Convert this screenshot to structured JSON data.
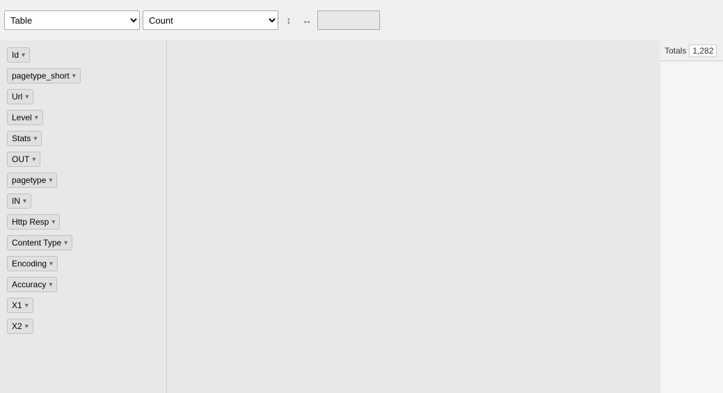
{
  "toolbar": {
    "table_select": {
      "value": "Table",
      "options": [
        "Table"
      ]
    },
    "count_select": {
      "value": "Count",
      "options": [
        "Count"
      ]
    },
    "sort_icon": "↕",
    "expand_icon": "↔"
  },
  "totals": {
    "label": "Totals",
    "value": "1,282"
  },
  "fields": [
    {
      "name": "Id"
    },
    {
      "name": "pagetype_short"
    },
    {
      "name": "Url"
    },
    {
      "name": "Level"
    },
    {
      "name": "Stats"
    },
    {
      "name": "OUT"
    },
    {
      "name": "pagetype"
    },
    {
      "name": "IN"
    },
    {
      "name": "Http Resp"
    },
    {
      "name": "Content Type"
    },
    {
      "name": "Encoding"
    },
    {
      "name": "Accuracy"
    },
    {
      "name": "X1"
    },
    {
      "name": "X2"
    }
  ]
}
